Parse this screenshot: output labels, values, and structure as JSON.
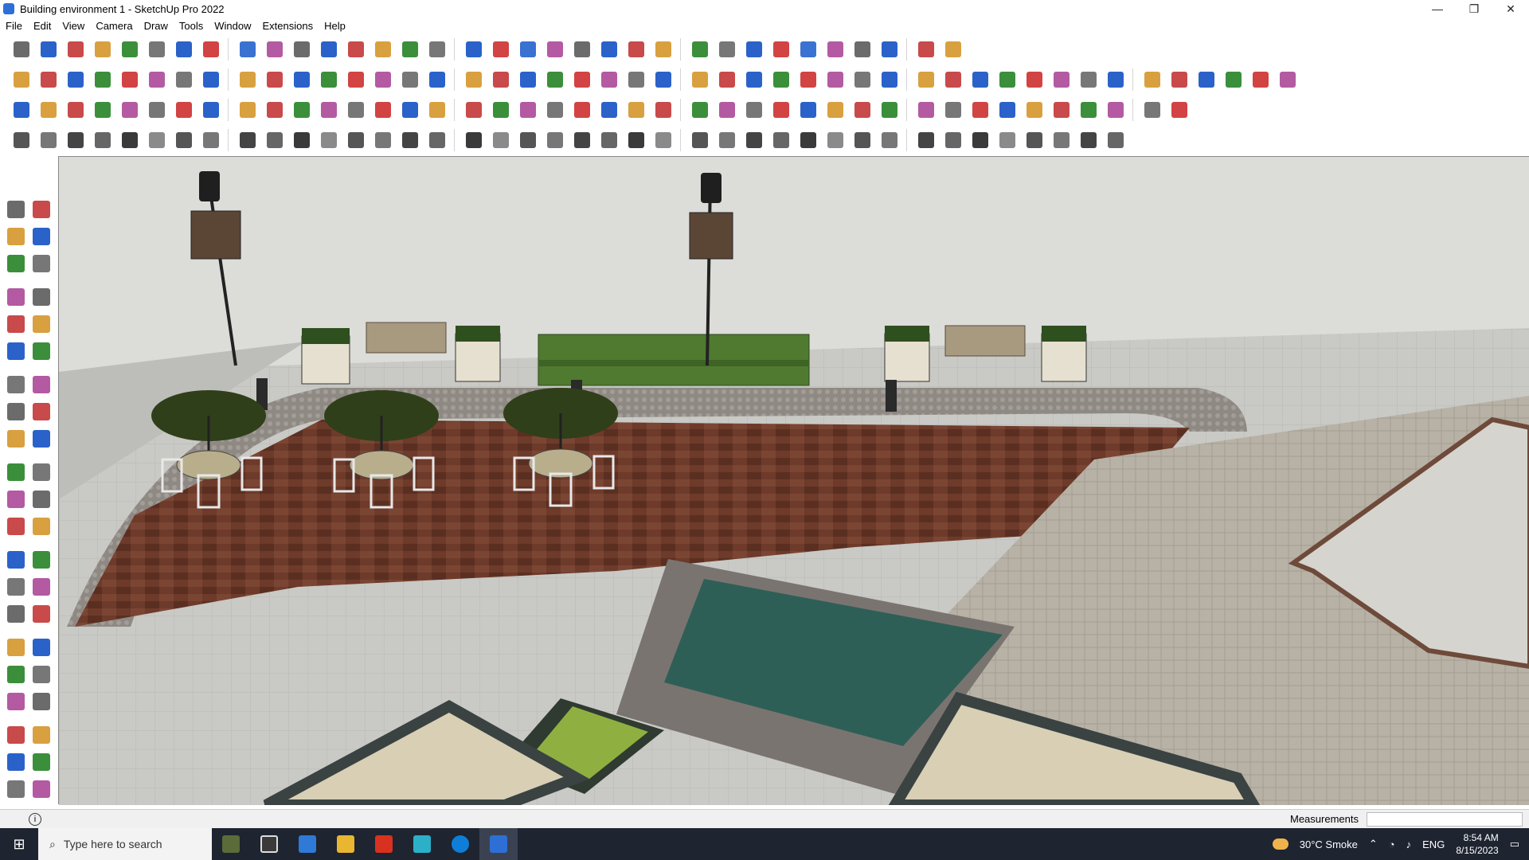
{
  "window": {
    "title": "Building environment 1 - SketchUp Pro 2022",
    "minimize": "—",
    "restore": "❐",
    "close": "✕"
  },
  "menu": [
    "File",
    "Edit",
    "View",
    "Camera",
    "Draw",
    "Tools",
    "Window",
    "Extensions",
    "Help"
  ],
  "toolbar_rows": [
    {
      "count": 34,
      "colors": [
        "#6b6b6b",
        "#2a62c9",
        "#c84a4a",
        "#d9a040",
        "#3b8f3b",
        "#777",
        "#2a62c9",
        "#d24343",
        "#3a72d2",
        "#b35aa2"
      ]
    },
    {
      "count": 46,
      "colors": [
        "#d9a040",
        "#c84a4a",
        "#2a62c9",
        "#3b8f3b",
        "#d24343",
        "#b35aa2",
        "#777",
        "#2a62c9"
      ]
    },
    {
      "count": 42,
      "colors": [
        "#2a62c9",
        "#d9a040",
        "#c84a4a",
        "#3b8f3b",
        "#b35aa2",
        "#777",
        "#d24343"
      ]
    },
    {
      "count": 40,
      "colors": [
        "#555",
        "#777",
        "#444",
        "#666",
        "#3a3a3a",
        "#8a8a8a"
      ]
    }
  ],
  "left_tools": [
    "select-icon",
    "orbit-icon",
    "paint-bucket-icon",
    "eraser-icon",
    "components-icon",
    "tape-icon",
    "line-icon",
    "freehand-icon",
    "rectangle-icon",
    "rotated-rect-icon",
    "circle-icon",
    "polygon-icon",
    "arc-icon",
    "pie-icon",
    "3pt-arc-icon",
    "offset-icon",
    "move-icon",
    "push-pull-icon",
    "rotate-icon",
    "follow-me-icon",
    "scale-icon",
    "offset-icon-2",
    "tape-measure-icon",
    "dimension-icon",
    "protractor-icon",
    "text-icon",
    "axes-icon",
    "3d-text-icon",
    "orbit-icon-2",
    "pan-icon",
    "zoom-icon",
    "zoom-window-icon",
    "zoom-extents-icon",
    "previous-view-icon",
    "position-camera-icon",
    "look-around-icon",
    "walk-icon",
    "section-plane-icon",
    "layers-icon",
    "outliner-icon",
    "warehouse-icon",
    "extension-icon"
  ],
  "status": {
    "info_icon": "i",
    "measurements_label": "Measurements"
  },
  "taskbar": {
    "search_placeholder": "Type here to search",
    "weather": "30°C  Smoke",
    "lang": "ENG",
    "time": "8:54 AM",
    "date": "8/15/2023"
  }
}
